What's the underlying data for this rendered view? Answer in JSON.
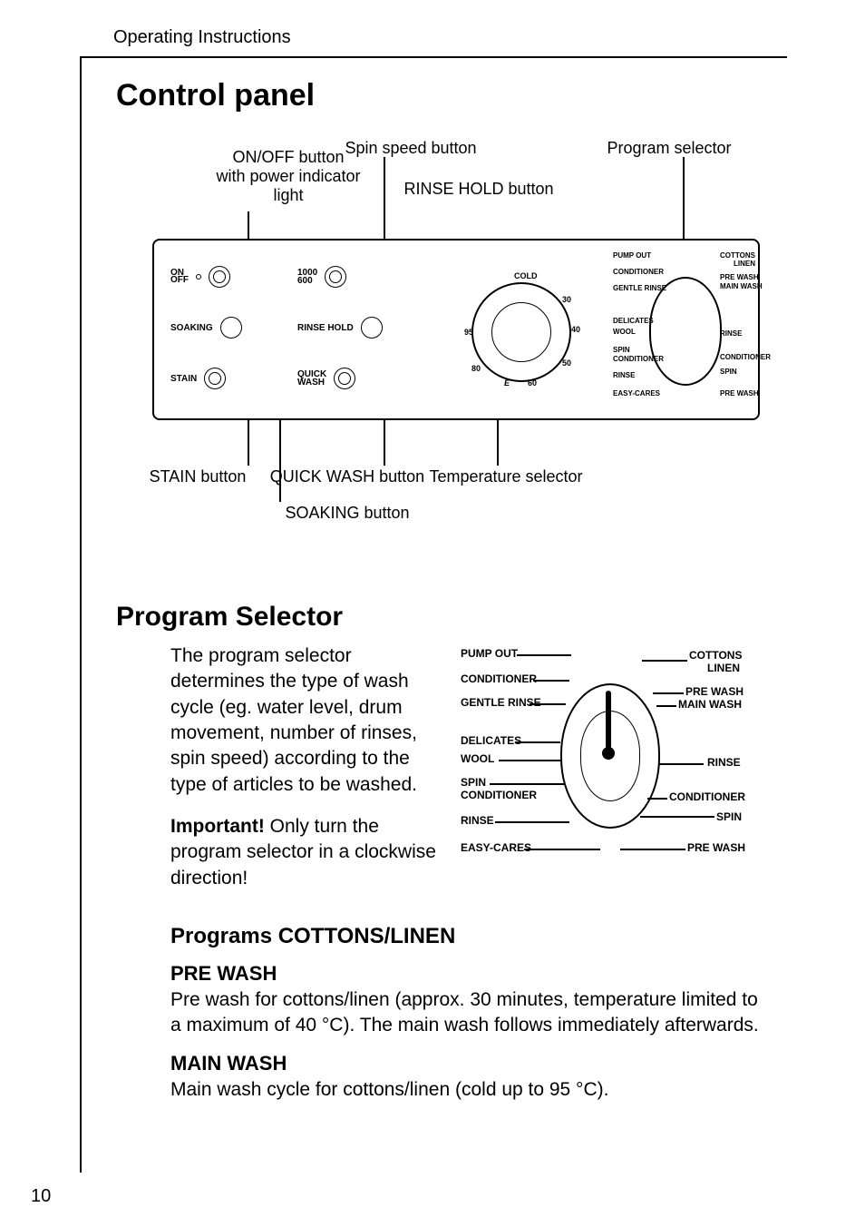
{
  "running_head": "Operating Instructions",
  "page_number": "10",
  "h_control_panel": "Control panel",
  "h_program_selector": "Program Selector",
  "h_programs_cottons": "Programs COTTONS/LINEN",
  "h_pre_wash": "PRE WASH",
  "h_main_wash": "MAIN WASH",
  "body_selector": "The program selector determines the type of wash cycle (eg. water level, drum movement, number of rinses, spin speed) according to the type of articles to be washed.",
  "body_important_strong": "Important!",
  "body_important_rest": " Only turn the program selector in a clockwise direction!",
  "body_prewash": "Pre wash for cottons/linen (approx. 30 minutes, temperature limited to a maximum of 40 °C). The main wash follows immediately afterwards.",
  "body_mainwash": "Main wash cycle for cottons/linen (cold up to 95 °C).",
  "cp": {
    "lbl_spin": "Spin speed button",
    "lbl_prog": "Program selector",
    "lbl_onoff1": "ON/OFF button",
    "lbl_onoff2": "with power indicator",
    "lbl_onoff3": "light",
    "lbl_rinse": "RINSE HOLD button",
    "lbl_stain": "STAIN button",
    "lbl_quick": "QUICK WASH button",
    "lbl_temp": "Temperature selector",
    "lbl_soak": "SOAKING button",
    "btn_onoff": "ON\nOFF",
    "btn_1000a": "1000",
    "btn_1000b": "600",
    "btn_soak": "SOAKING",
    "btn_rinsehold": "RINSE HOLD",
    "btn_stain": "STAIN",
    "btn_quick": "QUICK\nWASH",
    "temp_cold": "COLD",
    "temp_30": "30",
    "temp_40": "40",
    "temp_50": "50",
    "temp_60": "60",
    "temp_e": "E",
    "temp_80": "80",
    "temp_95": "95"
  },
  "prog": {
    "pump": "PUMP OUT",
    "cond": "CONDITIONER",
    "grinse": "GENTLE RINSE",
    "del": "DELICATES",
    "wool": "WOOL",
    "spin": "SPIN",
    "rinse": "RINSE",
    "easy": "EASY-CARES",
    "cott": "COTTONS",
    "linen": "LINEN",
    "pre": "PRE WASH",
    "main": "MAIN WASH"
  }
}
